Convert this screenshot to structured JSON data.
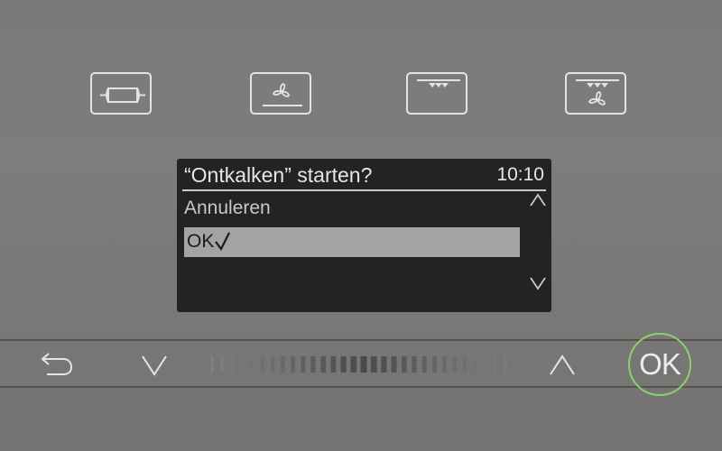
{
  "modes": [
    {
      "icon": "rotisserie-icon"
    },
    {
      "icon": "fan-bottom-heat-icon"
    },
    {
      "icon": "top-heat-icon"
    },
    {
      "icon": "fan-top-heat-icon"
    }
  ],
  "display": {
    "title": "“Ontkalken” starten?",
    "time": "10:10",
    "menu": {
      "cancel_label": "Annuleren",
      "ok_label": "OK"
    }
  },
  "controls": {
    "back_icon": "back-arrow-icon",
    "down_icon": "chevron-down-icon",
    "up_icon": "chevron-up-icon",
    "ok_label": "OK"
  },
  "colors": {
    "panel": "#7b7a78",
    "display_bg": "#232323",
    "selection_bg": "#a3a3a3",
    "ok_ring": "#8ed06a",
    "icon_stroke": "#e4e3e1"
  }
}
